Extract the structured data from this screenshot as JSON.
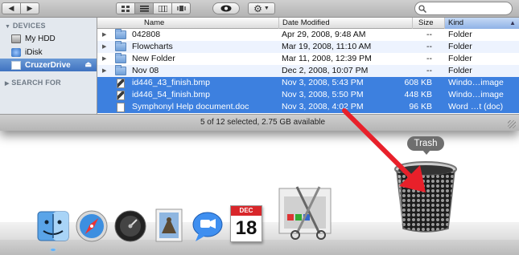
{
  "toolbar": {
    "back_icon": "back-arrow-icon",
    "forward_icon": "forward-arrow-icon",
    "view_modes": [
      "icon-view",
      "list-view",
      "column-view",
      "cover-flow-view"
    ],
    "quicklook_icon": "eye-icon",
    "action_icon": "gear-icon",
    "search_placeholder": ""
  },
  "sidebar": {
    "devices_heading": "DEVICES",
    "items": [
      {
        "label": "My HDD",
        "icon": "hard-drive-icon"
      },
      {
        "label": "iDisk",
        "icon": "idisk-icon"
      },
      {
        "label": "CruzerDrive",
        "icon": "usb-drive-icon",
        "selected": true
      }
    ],
    "eject_icon": "eject-icon",
    "search_heading": "SEARCH FOR"
  },
  "columns": {
    "name": "Name",
    "date": "Date Modified",
    "size": "Size",
    "kind": "Kind"
  },
  "files": [
    {
      "name": "042808",
      "date": "Apr 29, 2008, 9:48 AM",
      "size": "--",
      "kind": "Folder",
      "type": "folder",
      "selected": false
    },
    {
      "name": "Flowcharts",
      "date": "Mar 19, 2008, 11:10 AM",
      "size": "--",
      "kind": "Folder",
      "type": "folder",
      "selected": false
    },
    {
      "name": "New Folder",
      "date": "Mar 11, 2008, 12:39 PM",
      "size": "--",
      "kind": "Folder",
      "type": "folder",
      "selected": false
    },
    {
      "name": "Nov 08",
      "date": "Dec 2, 2008, 10:07 PM",
      "size": "--",
      "kind": "Folder",
      "type": "folder",
      "selected": false
    },
    {
      "name": "id446_43_finish.bmp",
      "date": "Nov 3, 2008, 5:43 PM",
      "size": "608 KB",
      "kind": "Windo…image",
      "type": "bmp",
      "selected": true
    },
    {
      "name": "id446_54_finish.bmp",
      "date": "Nov 3, 2008, 5:50 PM",
      "size": "448 KB",
      "kind": "Windo…image",
      "type": "bmp",
      "selected": true
    },
    {
      "name": "Symphonyl Help document.doc",
      "date": "Nov 3, 2008, 4:02 PM",
      "size": "96 KB",
      "kind": "Word …t (doc)",
      "type": "doc",
      "selected": true
    }
  ],
  "status": {
    "text": "5 of 12 selected, 2.75 GB available"
  },
  "dock": {
    "items": [
      "finder-icon",
      "safari-icon",
      "dashboard-icon",
      "mail-icon",
      "ichat-icon",
      "ical-icon",
      "preview-icon",
      "trash-icon"
    ],
    "ical_month": "DEC",
    "ical_day": "18",
    "trash_label": "Trash"
  },
  "colors": {
    "selection": "#3d80df",
    "arrow": "#e8202a",
    "sidebar_bg": "#e3e8ee"
  }
}
